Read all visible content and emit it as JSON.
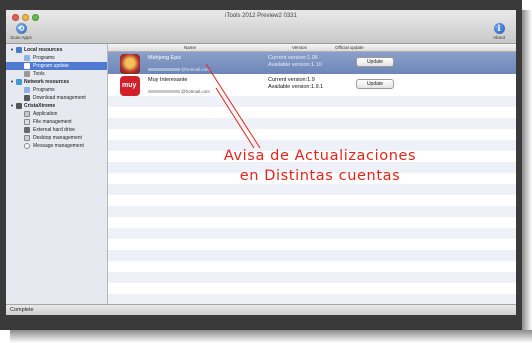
{
  "window": {
    "title": "iTools 2012 Preview2 0331",
    "status": "Complete"
  },
  "toolbar": {
    "scan_label": "Scan Apps",
    "about_label": "About",
    "about_icon": "info-icon",
    "scan_icon": "scan-icon"
  },
  "sidebar": {
    "sections": [
      {
        "label": "Local resources",
        "items": [
          "Programs",
          "Program update",
          "Tools"
        ]
      },
      {
        "label": "Network resources",
        "items": [
          "Programs",
          "Download management"
        ]
      },
      {
        "label": "CristaXtreme",
        "items": [
          "Application",
          "File management",
          "External hard drive",
          "Desktop management",
          "Message management"
        ]
      }
    ],
    "selected": "Program update"
  },
  "table": {
    "columns": [
      "Name",
      "Version",
      "Official update"
    ],
    "rows": [
      {
        "name": "Mahjong Epic",
        "email": "@hotmail.com",
        "current": "Current version:1.06",
        "available": "Available version:1.10",
        "button": "Update"
      },
      {
        "name": "Muy Interesante",
        "email": "@hotmail.com",
        "current": "Current version:1.9",
        "available": "Available version:1.9.1",
        "button": "Update"
      }
    ]
  },
  "annotation": {
    "line1": "Avisa de Actualizaciones",
    "line2": "en Distintas cuentas",
    "color": "#e8231c"
  },
  "colors": {
    "selection": "#4f7ad0",
    "stripe": "#eef1f7"
  }
}
